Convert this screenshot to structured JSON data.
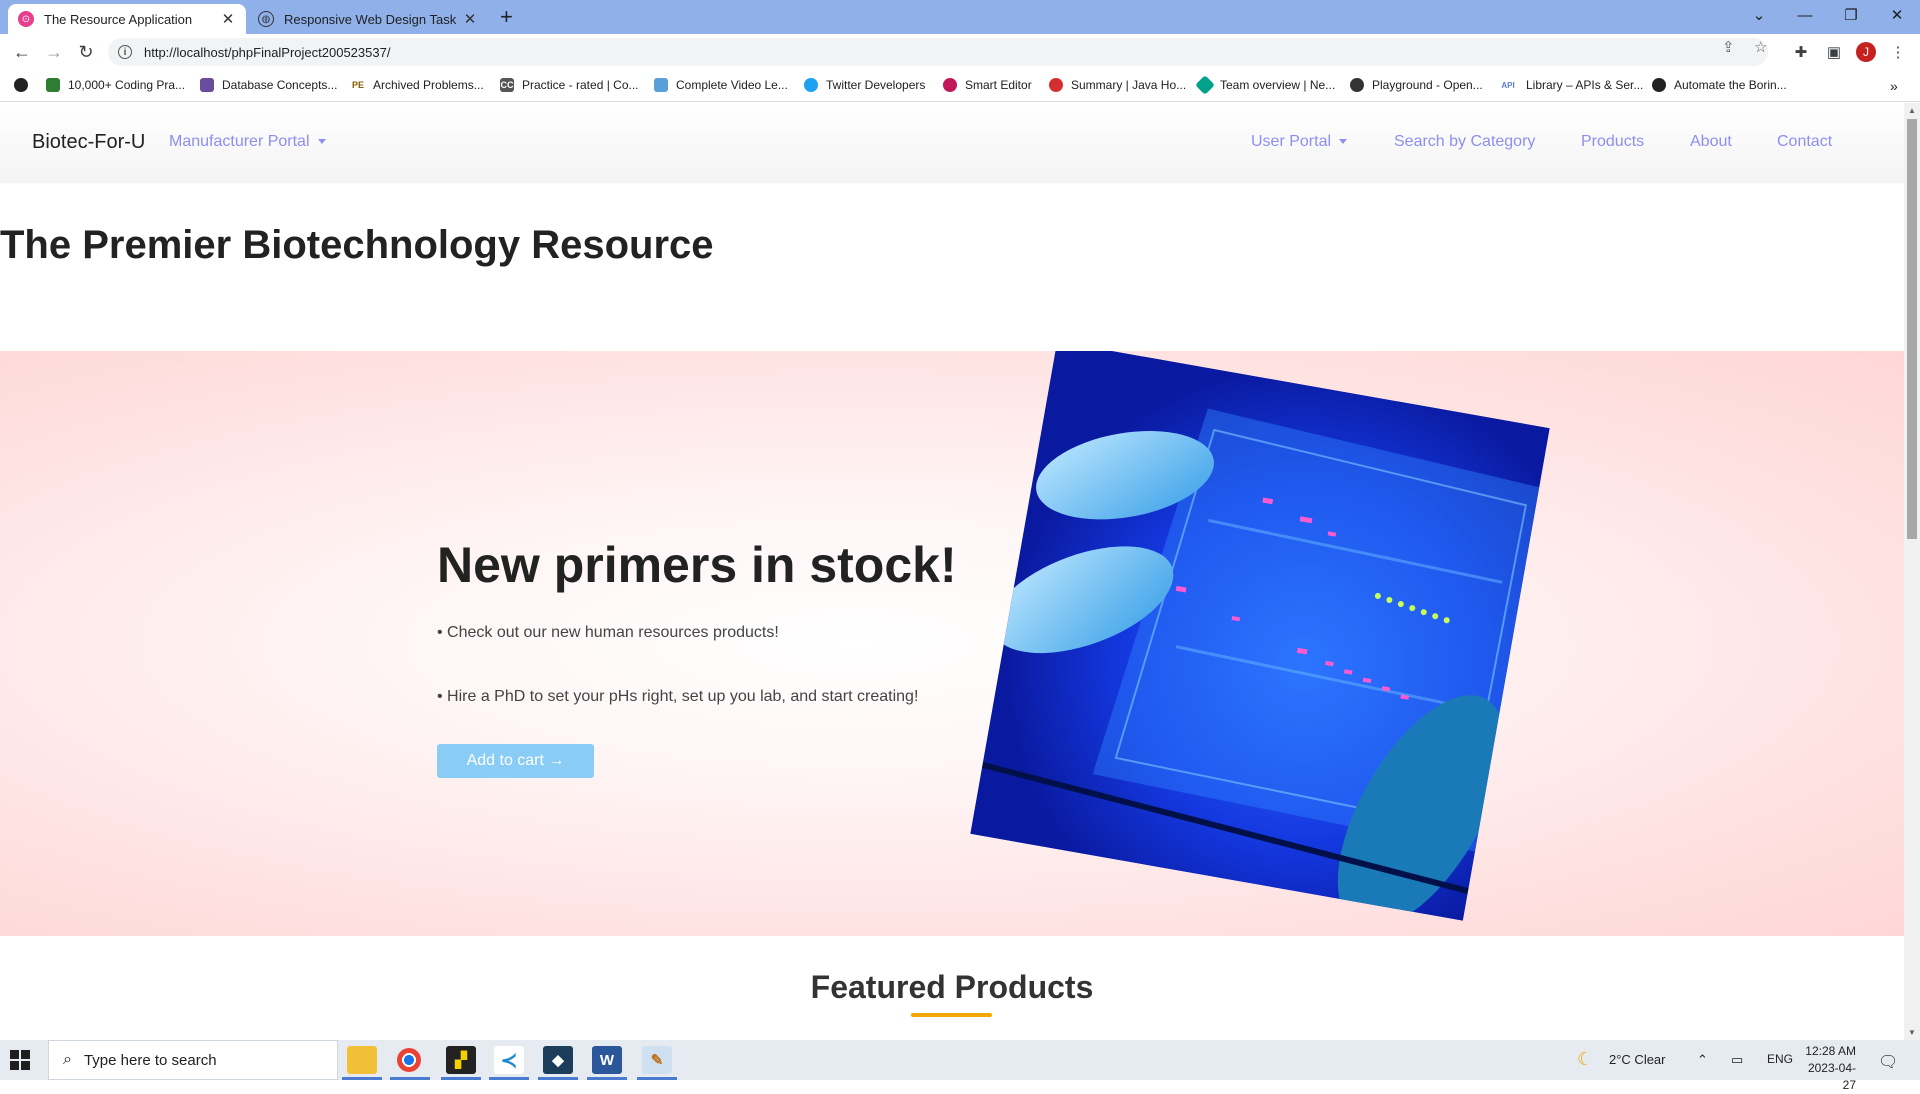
{
  "browser": {
    "tabs": [
      {
        "title": "The Resource Application",
        "active": true
      },
      {
        "title": "Responsive Web Design Task: Ta",
        "active": false
      }
    ],
    "url": "http://localhost/phpFinalProject200523537/",
    "profile_initial": "J",
    "bookmarks": [
      {
        "label": "10,000+ Coding Pra...",
        "icon_color": "#2e7d32"
      },
      {
        "label": "Database Concepts...",
        "icon_color": "#6a4c9c"
      },
      {
        "label": "Archived Problems...",
        "icon_color": "#8a5a00",
        "icon_text": "PE"
      },
      {
        "label": "Practice - rated | Co...",
        "icon_color": "#555555",
        "icon_text": "CC"
      },
      {
        "label": "Complete Video Le...",
        "icon_color": "#5aa0d8"
      },
      {
        "label": "Twitter Developers",
        "icon_color": "#1da1f2"
      },
      {
        "label": "Smart Editor",
        "icon_color": "#c2185b"
      },
      {
        "label": "Summary | Java Ho...",
        "icon_color": "#d32f2f"
      },
      {
        "label": "Team overview | Ne...",
        "icon_color": "#00a38a"
      },
      {
        "label": "Playground - Open...",
        "icon_color": "#333333"
      },
      {
        "label": "Library – APIs & Ser...",
        "icon_color": "#5b7bd6",
        "icon_text": "API"
      },
      {
        "label": "Automate the Borin...",
        "icon_color": "#222222"
      }
    ]
  },
  "site": {
    "brand": "Biotec-For-U",
    "nav": {
      "manufacturer_portal": "Manufacturer Portal",
      "user_portal": "User Portal",
      "search_by_category": "Search by Category",
      "products": "Products",
      "about": "About",
      "contact": "Contact"
    },
    "hero_title": "The Premier Biotechnology Resource",
    "promo": {
      "heading": "New primers in stock!",
      "bullet1": "• Check out our new human resources products!",
      "bullet2": "• Hire a PhD to set your pHs right, set up you lab, and start creating!",
      "cta": "Add to cart →"
    },
    "featured_title": "Featured Products"
  },
  "taskbar": {
    "search_placeholder": "Type here to search",
    "weather": "2°C  Clear",
    "language": "ENG",
    "time": "12:28 AM",
    "date": "2023-04-27"
  }
}
